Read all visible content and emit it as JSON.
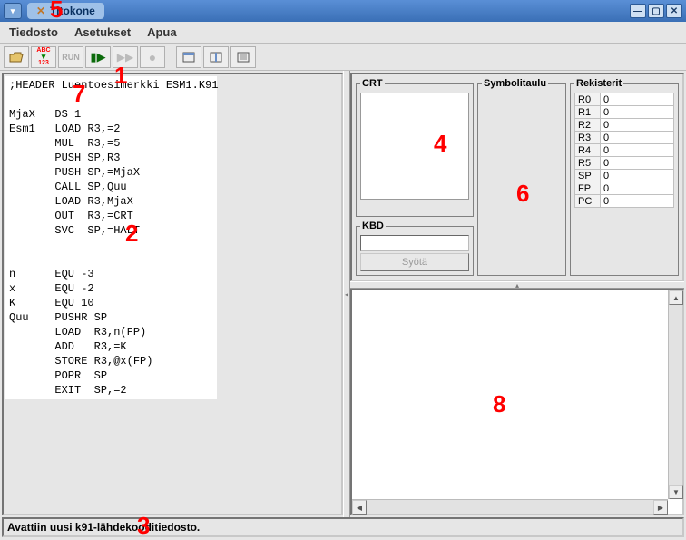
{
  "window": {
    "title": "Titokone"
  },
  "menu": {
    "file": "Tiedosto",
    "settings": "Asetukset",
    "help": "Apua"
  },
  "toolbar": {
    "compile_top": "ABC",
    "compile_bot": "123",
    "run": "RUN"
  },
  "code": ";HEADER Luentoesimerkki ESM1.K91\n\nMjaX   DS 1\nEsm1   LOAD R3,=2\n       MUL  R3,=5\n       PUSH SP,R3\n       PUSH SP,=MjaX\n       CALL SP,Quu\n       LOAD R3,MjaX\n       OUT  R3,=CRT\n       SVC  SP,=HALT\n\n\nn      EQU -3\nx      EQU -2\nK      EQU 10\nQuu    PUSHR SP\n       LOAD  R3,n(FP)\n       ADD   R3,=K\n       STORE R3,@x(FP)\n       POPR  SP\n       EXIT  SP,=2",
  "panels": {
    "crt": "CRT",
    "kbd": "KBD",
    "kbd_button": "Syötä",
    "sym": "Symbolitaulu",
    "reg": "Rekisterit"
  },
  "registers": [
    {
      "name": "R0",
      "val": "0"
    },
    {
      "name": "R1",
      "val": "0"
    },
    {
      "name": "R2",
      "val": "0"
    },
    {
      "name": "R3",
      "val": "0"
    },
    {
      "name": "R4",
      "val": "0"
    },
    {
      "name": "R5",
      "val": "0"
    },
    {
      "name": "SP",
      "val": "0"
    },
    {
      "name": "FP",
      "val": "0"
    },
    {
      "name": "PC",
      "val": "0"
    }
  ],
  "status": "Avattiin uusi k91-lähdekooditiedosto.",
  "annotations": {
    "a1": "1",
    "a2": "2",
    "a3": "3",
    "a4": "4",
    "a5": "5",
    "a6": "6",
    "a7": "7",
    "a8": "8"
  }
}
